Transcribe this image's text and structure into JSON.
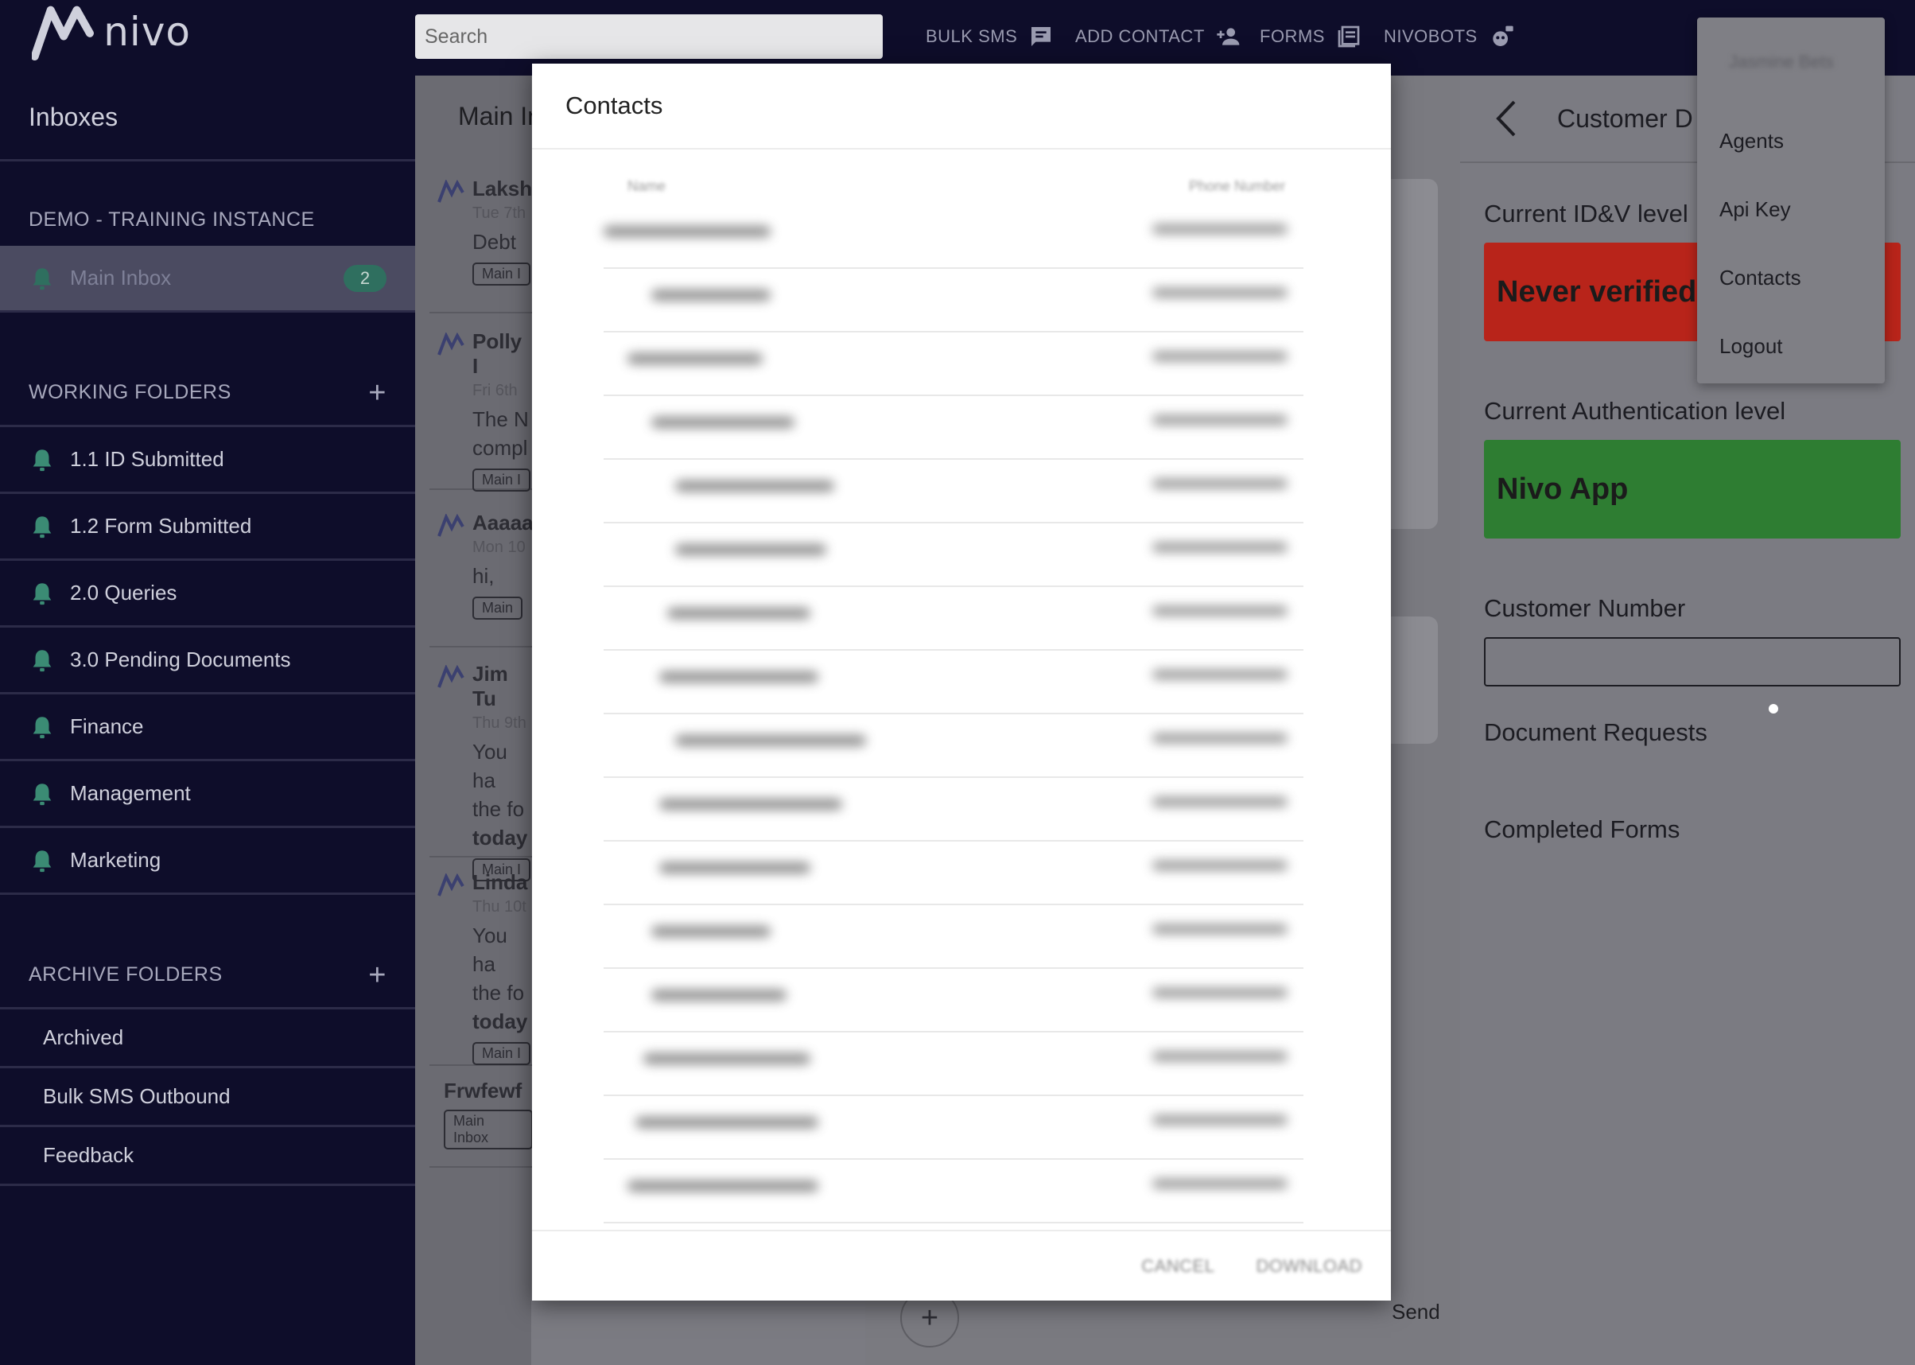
{
  "app": {
    "logo_text": "nivo"
  },
  "topbar": {
    "search_placeholder": "Search",
    "nav": [
      {
        "label": "BULK SMS",
        "icon": "chat-icon"
      },
      {
        "label": "ADD CONTACT",
        "icon": "add-person-icon"
      },
      {
        "label": "FORMS",
        "icon": "forms-icon"
      },
      {
        "label": "NIVOBOTS",
        "icon": "bot-icon"
      }
    ]
  },
  "sidebar": {
    "title": "Inboxes",
    "instance": "DEMO - TRAINING INSTANCE",
    "main_inbox": {
      "label": "Main Inbox",
      "count": "2"
    },
    "working_title": "WORKING FOLDERS",
    "working": [
      "1.1 ID Submitted",
      "1.2 Form Submitted",
      "2.0 Queries",
      "3.0 Pending Documents",
      "Finance",
      "Management",
      "Marketing"
    ],
    "archive_title": "ARCHIVE FOLDERS",
    "archive": [
      "Archived",
      "Bulk SMS Outbound",
      "Feedback"
    ]
  },
  "conversations": {
    "title": "Main In",
    "items": [
      {
        "name": "Laksh",
        "date": "Tue 7th",
        "text": [
          "Debt"
        ],
        "chip": "Main I"
      },
      {
        "name": "Polly I",
        "date": "Fri 6th",
        "text": [
          "The N",
          "compl"
        ],
        "chip": "Main I"
      },
      {
        "name": "Aaaaa",
        "date": "Mon 10",
        "text": [
          "hi,"
        ],
        "chip": "Main"
      },
      {
        "name": "Jim Tu",
        "date": "Thu 9th",
        "text": [
          "You ha",
          "the fo",
          "today"
        ],
        "chip": "Main I"
      },
      {
        "name": "Linda",
        "date": "Thu 10t",
        "text": [
          "You ha",
          "the fo",
          "today"
        ],
        "chip": "Main I"
      },
      {
        "name": "Frwfewf",
        "date": "",
        "text": [],
        "chip": "Main Inbox"
      }
    ]
  },
  "chat": {
    "send_label": "Send",
    "add_symbol": "+"
  },
  "right_panel": {
    "title": "Customer D",
    "idv_label": "Current ID&V level",
    "idv_value": "Never verified",
    "idv_color": "#b8241a",
    "auth_label": "Current Authentication level",
    "auth_value": "Nivo App",
    "auth_color": "#2e7d32",
    "customer_number_label": "Customer Number",
    "customer_number_value": "",
    "doc_requests_label": "Document Requests",
    "completed_forms_label": "Completed Forms"
  },
  "user_menu": {
    "user_name": "Jasmine Bets",
    "items": [
      "Agents",
      "Api Key",
      "Contacts",
      "Logout"
    ]
  },
  "modal": {
    "title": "Contacts",
    "col_name": "Name",
    "col_phone": "Phone Number",
    "cancel_label": "CANCEL",
    "download_label": "DOWNLOAD"
  }
}
